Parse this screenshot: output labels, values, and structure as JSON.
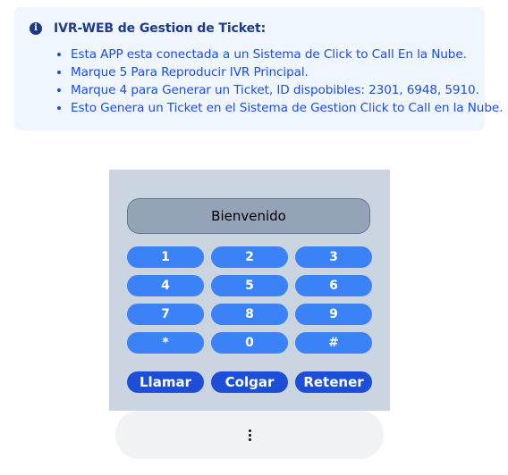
{
  "info": {
    "icon": "info-icon",
    "title": "IVR-WEB de Gestion de Ticket:",
    "items": [
      "Esta APP esta conectada a un Sistema de Click to Call En la Nube.",
      "Marque 5 Para Reproducir IVR Principal.",
      "Marque 4 para Generar un Ticket, ID dispobibles: 2301, 6948, 5910.",
      "Esto Genera un Ticket en el Sistema de Gestion Click to Call en la Nube."
    ]
  },
  "phone": {
    "display": "Bienvenido",
    "keys": [
      "1",
      "2",
      "3",
      "4",
      "5",
      "6",
      "7",
      "8",
      "9",
      "*",
      "0",
      "#"
    ],
    "actions": {
      "call": "Llamar",
      "hangup": "Colgar",
      "hold": "Retener"
    }
  },
  "more_menu": {
    "icon": "vertical-ellipsis-icon"
  },
  "colors": {
    "info_bg": "#eff6ff",
    "info_text": "#1d4ed8",
    "info_title": "#1e3a8a",
    "phone_bg": "#cbd5e1",
    "display_bg": "#94a3b8",
    "key_bg": "#3b82f6",
    "action_bg": "#1d4ed8"
  }
}
